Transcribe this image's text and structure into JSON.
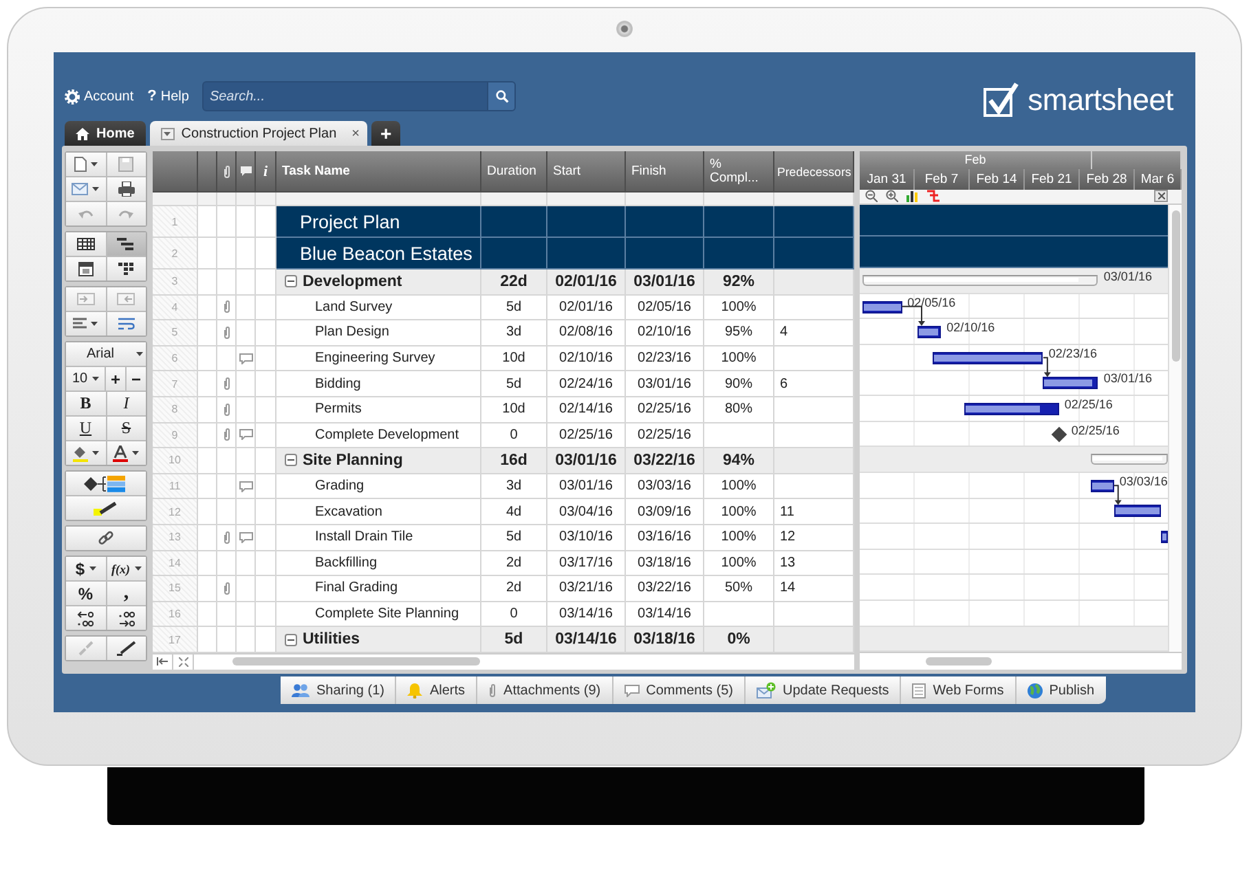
{
  "topbar": {
    "account": "Account",
    "help_icon": "?",
    "help": "Help",
    "search": {
      "placeholder": "Search..."
    },
    "logo": "smartsheet"
  },
  "tabs": [
    {
      "label": "Home",
      "kind": "home",
      "selected": false
    },
    {
      "label": "Construction Project Plan",
      "kind": "sheet",
      "selected": true,
      "close": "×"
    }
  ],
  "add_tab": "+",
  "toolbar": {
    "views": [
      {
        "selected": false
      },
      {
        "selected": true
      },
      {
        "selected": false
      },
      {
        "selected": false
      }
    ],
    "font": "Arial",
    "font_size": "10",
    "increase": "+",
    "decrease": "−",
    "bold": "B",
    "italic": "I",
    "underline": "U",
    "strikethrough": "S",
    "currency": "$",
    "formula": "f(x)",
    "percent": "%",
    "comma": ","
  },
  "columns": [
    {
      "kind": "rownum"
    },
    {
      "kind": "flag"
    },
    {
      "kind": "attachment"
    },
    {
      "kind": "comment"
    },
    {
      "kind": "info",
      "label": "i"
    },
    {
      "kind": "task",
      "label": "Task Name"
    },
    {
      "kind": "duration",
      "label": "Duration"
    },
    {
      "kind": "start",
      "label": "Start"
    },
    {
      "kind": "finish",
      "label": "Finish"
    },
    {
      "kind": "complete",
      "label": "% Compl..."
    },
    {
      "kind": "predecessors",
      "label": "Predecessors"
    }
  ],
  "rows": [
    {
      "num": "1",
      "kind": "title",
      "name": "Project Plan",
      "attachment": false,
      "comment": false
    },
    {
      "num": "2",
      "kind": "title",
      "name": "Blue Beacon Estates",
      "attachment": false,
      "comment": false
    },
    {
      "num": "3",
      "kind": "section",
      "name": "Development",
      "expanded": true,
      "duration": "22d",
      "start": "02/01/16",
      "finish": "03/01/16",
      "complete": "92%",
      "attachment": false,
      "comment": false,
      "gantt_label": "03/01/16"
    },
    {
      "num": "4",
      "kind": "task",
      "name": "Land Survey",
      "duration": "5d",
      "start": "02/01/16",
      "finish": "02/05/16",
      "complete": "100%",
      "attachment": true,
      "comment": false,
      "gantt_label": "02/05/16"
    },
    {
      "num": "5",
      "kind": "task",
      "name": "Plan Design",
      "duration": "3d",
      "start": "02/08/16",
      "finish": "02/10/16",
      "complete": "95%",
      "predecessors": "4",
      "attachment": true,
      "comment": false,
      "gantt_label": "02/10/16"
    },
    {
      "num": "6",
      "kind": "task",
      "name": "Engineering Survey",
      "duration": "10d",
      "start": "02/10/16",
      "finish": "02/23/16",
      "complete": "100%",
      "attachment": false,
      "comment": true,
      "gantt_label": "02/23/16"
    },
    {
      "num": "7",
      "kind": "task",
      "name": "Bidding",
      "duration": "5d",
      "start": "02/24/16",
      "finish": "03/01/16",
      "complete": "90%",
      "predecessors": "6",
      "attachment": true,
      "comment": false,
      "gantt_label": "03/01/16"
    },
    {
      "num": "8",
      "kind": "task",
      "name": "Permits",
      "duration": "10d",
      "start": "02/14/16",
      "finish": "02/25/16",
      "complete": "80%",
      "attachment": true,
      "comment": false,
      "gantt_label": "02/25/16"
    },
    {
      "num": "9",
      "kind": "milestone",
      "name": "Complete Development",
      "duration": "0",
      "start": "02/25/16",
      "finish": "02/25/16",
      "attachment": true,
      "comment": true,
      "gantt_label": "02/25/16"
    },
    {
      "num": "10",
      "kind": "section",
      "name": "Site Planning",
      "expanded": true,
      "duration": "16d",
      "start": "03/01/16",
      "finish": "03/22/16",
      "complete": "94%",
      "attachment": false,
      "comment": false
    },
    {
      "num": "11",
      "kind": "task",
      "name": "Grading",
      "duration": "3d",
      "start": "03/01/16",
      "finish": "03/03/16",
      "complete": "100%",
      "attachment": false,
      "comment": true,
      "gantt_label": "03/03/16"
    },
    {
      "num": "12",
      "kind": "task",
      "name": "Excavation",
      "duration": "4d",
      "start": "03/04/16",
      "finish": "03/09/16",
      "complete": "100%",
      "predecessors": "11",
      "attachment": false,
      "comment": false
    },
    {
      "num": "13",
      "kind": "task",
      "name": "Install Drain Tile",
      "duration": "5d",
      "start": "03/10/16",
      "finish": "03/16/16",
      "complete": "100%",
      "predecessors": "12",
      "attachment": true,
      "comment": true
    },
    {
      "num": "14",
      "kind": "task",
      "name": "Backfilling",
      "duration": "2d",
      "start": "03/17/16",
      "finish": "03/18/16",
      "complete": "100%",
      "predecessors": "13",
      "attachment": false,
      "comment": false
    },
    {
      "num": "15",
      "kind": "task",
      "name": "Final Grading",
      "duration": "2d",
      "start": "03/21/16",
      "finish": "03/22/16",
      "complete": "50%",
      "predecessors": "14",
      "attachment": true,
      "comment": false
    },
    {
      "num": "16",
      "kind": "milestone",
      "name": "Complete Site Planning",
      "duration": "0",
      "start": "03/14/16",
      "finish": "03/14/16",
      "attachment": false,
      "comment": false
    },
    {
      "num": "17",
      "kind": "section",
      "name": "Utilities",
      "expanded": true,
      "duration": "5d",
      "start": "03/14/16",
      "finish": "03/18/16",
      "complete": "0%",
      "attachment": false,
      "comment": false
    }
  ],
  "gantt": {
    "month": "Feb",
    "weeks": [
      "Jan 31",
      "Feb 7",
      "Feb 14",
      "Feb 21",
      "Feb 28",
      "Mar 6"
    ]
  },
  "footer_tabs": [
    {
      "kind": "sharing",
      "label": "Sharing (1)"
    },
    {
      "kind": "alerts",
      "label": "Alerts"
    },
    {
      "kind": "attachments",
      "label": "Attachments (9)"
    },
    {
      "kind": "comments",
      "label": "Comments (5)"
    },
    {
      "kind": "requests",
      "label": "Update Requests"
    },
    {
      "kind": "forms",
      "label": "Web Forms"
    },
    {
      "kind": "publish",
      "label": "Publish"
    }
  ]
}
